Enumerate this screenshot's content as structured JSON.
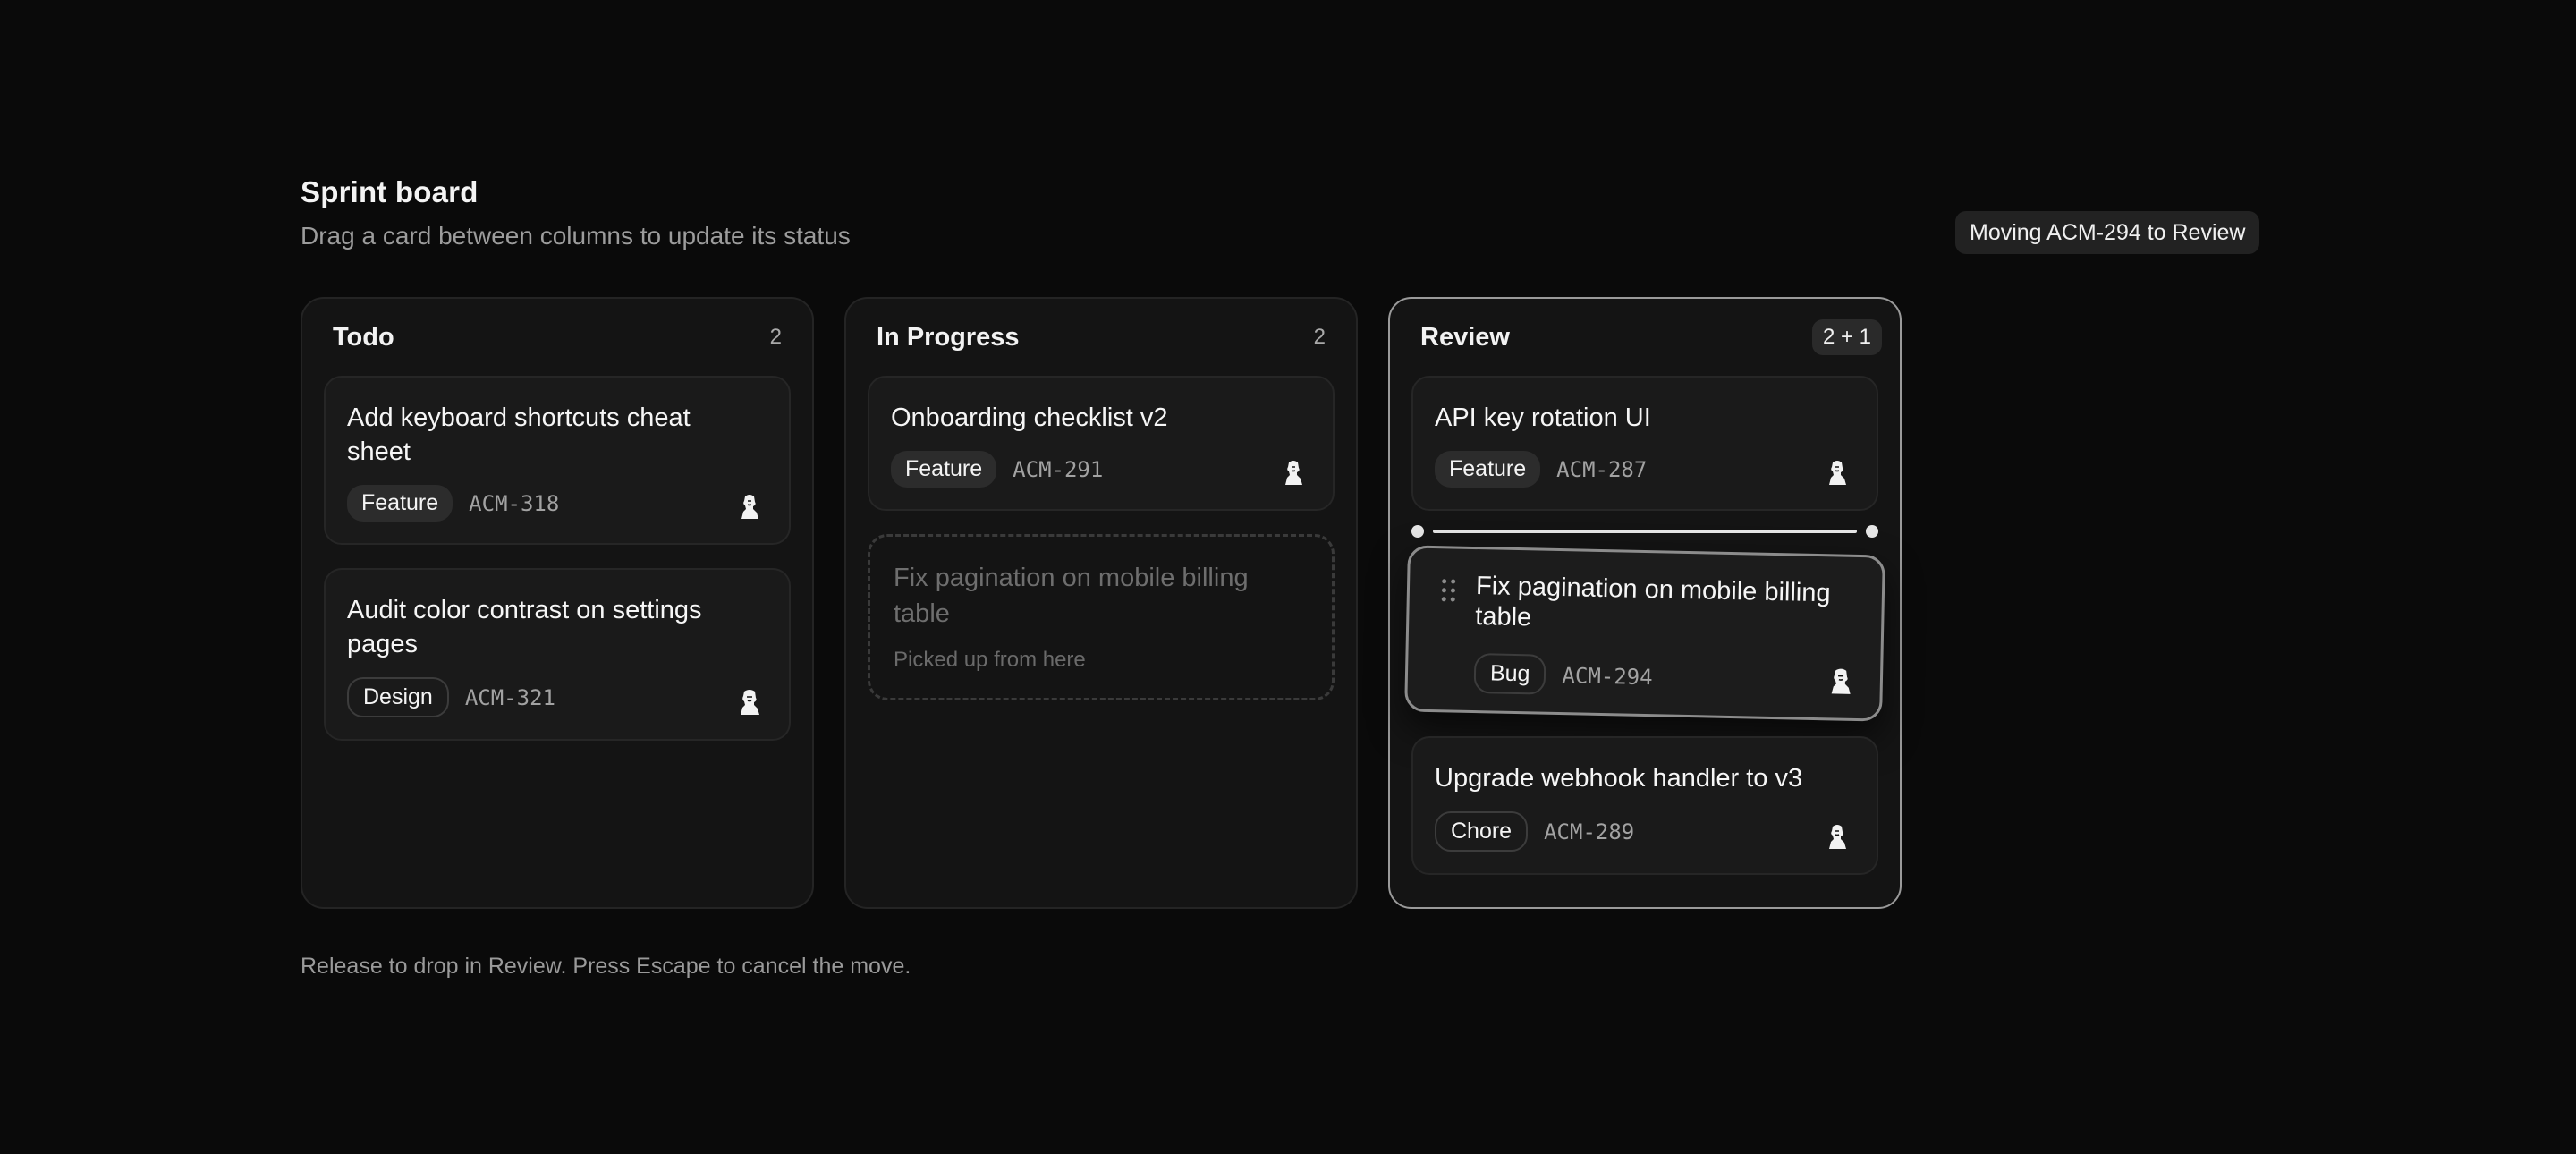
{
  "header": {
    "title": "Sprint board",
    "subtitle": "Drag a card between columns to update its status"
  },
  "toast": "Moving ACM-294 to Review",
  "columns": [
    {
      "title": "Todo",
      "count": "2",
      "cards": [
        {
          "title": "Add keyboard shortcuts cheat sheet",
          "tag": "Feature",
          "id": "ACM-318"
        },
        {
          "title": "Audit color contrast on settings pages",
          "tag": "Design",
          "id": "ACM-321"
        }
      ]
    },
    {
      "title": "In Progress",
      "count": "2",
      "cards": [
        {
          "title": "Onboarding checklist v2",
          "tag": "Feature",
          "id": "ACM-291"
        }
      ],
      "placeholder": {
        "title": "Fix pagination on mobile billing table",
        "note": "Picked up from here"
      }
    },
    {
      "title": "Review",
      "count": "2 + 1",
      "cards": [
        {
          "title": "API key rotation UI",
          "tag": "Feature",
          "id": "ACM-287"
        },
        {
          "title": "Upgrade webhook handler to v3",
          "tag": "Chore",
          "id": "ACM-289"
        }
      ],
      "dragging": {
        "title": "Fix pagination on mobile billing table",
        "tag": "Bug",
        "id": "ACM-294"
      }
    }
  ],
  "footer": "Release to drop in Review. Press Escape to cancel the move.",
  "colors": {
    "background": "#0a0a0a",
    "column": "#141414",
    "card": "#1a1a1a",
    "active_border": "#9a9a9a"
  }
}
